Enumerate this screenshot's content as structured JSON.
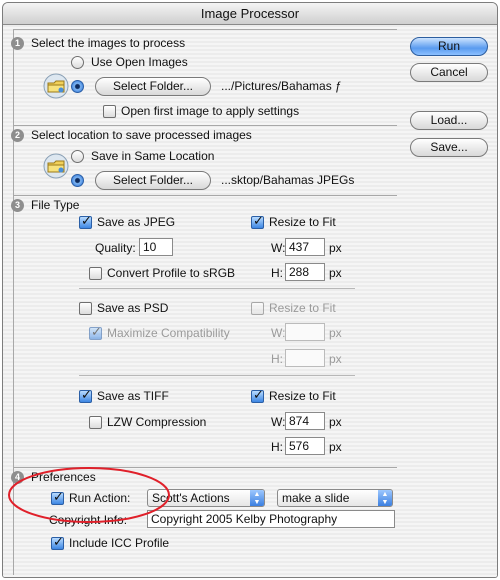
{
  "window": {
    "title": "Image Processor"
  },
  "section1": {
    "number": "1",
    "heading": "Select the images to process",
    "use_open": "Use Open Images",
    "select_folder": "Select Folder...",
    "path": ".../Pictures/Bahamas ƒ",
    "open_first": "Open first image to apply settings"
  },
  "section2": {
    "number": "2",
    "heading": "Select location to save processed images",
    "save_same": "Save in Same Location",
    "select_folder": "Select Folder...",
    "path": "...sktop/Bahamas JPEGs"
  },
  "section3": {
    "number": "3",
    "heading": "File Type",
    "jpeg": {
      "label": "Save as JPEG",
      "resize": "Resize to Fit",
      "quality_label": "Quality:",
      "quality": "10",
      "w_label": "W:",
      "w": "437",
      "h_label": "H:",
      "h": "288",
      "unit": "px",
      "convert": "Convert Profile to sRGB"
    },
    "psd": {
      "label": "Save as PSD",
      "resize": "Resize to Fit",
      "maximize": "Maximize Compatibility",
      "w_label": "W:",
      "h_label": "H:",
      "unit": "px"
    },
    "tiff": {
      "label": "Save as TIFF",
      "resize": "Resize to Fit",
      "lzw": "LZW Compression",
      "w_label": "W:",
      "w": "874",
      "h_label": "H:",
      "h": "576",
      "unit": "px"
    }
  },
  "section4": {
    "number": "4",
    "heading": "Preferences",
    "run_action": "Run Action:",
    "action_set": "Scott's Actions",
    "action": "make a slide",
    "copyright_label": "Copyright Info:",
    "copyright": "Copyright 2005 Kelby Photography",
    "icc": "Include ICC Profile"
  },
  "buttons": {
    "run": "Run",
    "cancel": "Cancel",
    "load": "Load...",
    "save": "Save..."
  },
  "icons": [
    "folder-icon",
    "checkmark-icon",
    "popup-arrows-icon",
    "step-number-icon"
  ],
  "colors": {
    "accent": "#3d86e3",
    "annotation": "#e0202a"
  }
}
